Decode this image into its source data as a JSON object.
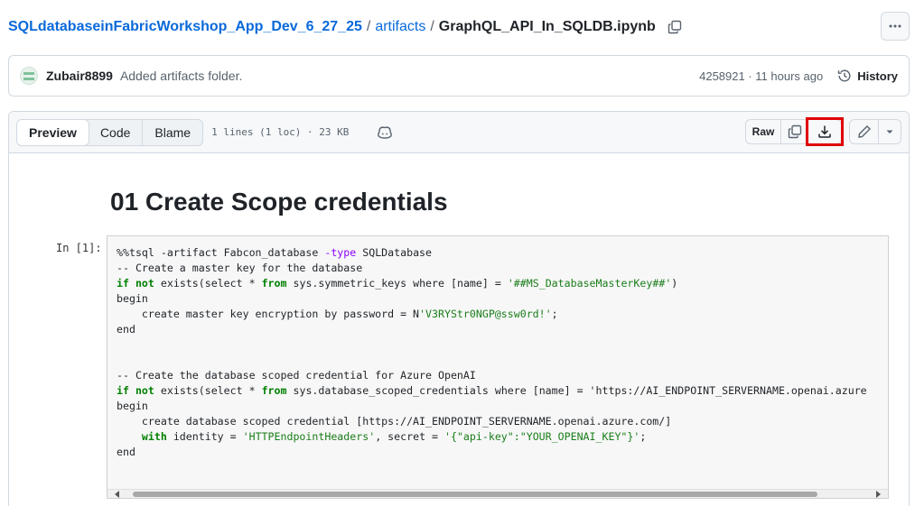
{
  "breadcrumb": {
    "repo": "SQLdatabaseinFabricWorkshop_App_Dev_6_27_25",
    "separator": "/",
    "folder": "artifacts",
    "file": "GraphQL_API_In_SQLDB.ipynb"
  },
  "commit": {
    "author": "Zubair8899",
    "message": "Added artifacts folder.",
    "hash_time": "4258921 · 11 hours ago",
    "history_label": "History"
  },
  "file_header": {
    "tabs": [
      {
        "label": "Preview",
        "active": true
      },
      {
        "label": "Code",
        "active": false
      },
      {
        "label": "Blame",
        "active": false
      }
    ],
    "meta": "1 lines (1 loc) · 23 KB",
    "raw_label": "Raw"
  },
  "notebook": {
    "title": "01 Create Scope credentials",
    "prompt": "In [1]:",
    "code_lines": [
      "%%tsql -artifact Fabcon_database -type SQLDatabase",
      "-- Create a master key for the database",
      "if not exists(select * from sys.symmetric_keys where [name] = '##MS_DatabaseMasterKey##')",
      "begin",
      "    create master key encryption by password = N'V3RYStr0NGP@ssw0rd!';",
      "end",
      "",
      "",
      "-- Create the database scoped credential for Azure OpenAI",
      "if not exists(select * from sys.database_scoped_credentials where [name] = 'https://AI_ENDPOINT_SERVERNAME.openai.azure",
      "begin",
      "    create database scoped credential [https://AI_ENDPOINT_SERVERNAME.openai.azure.com/]",
      "    with identity = 'HTTPEndpointHeaders', secret = '{\"api-key\":\"YOUR_OPENAI_KEY\"}';",
      "end"
    ]
  },
  "colors": {
    "link": "#0969da",
    "highlight": "#e00000",
    "border": "#d1d9e0"
  }
}
